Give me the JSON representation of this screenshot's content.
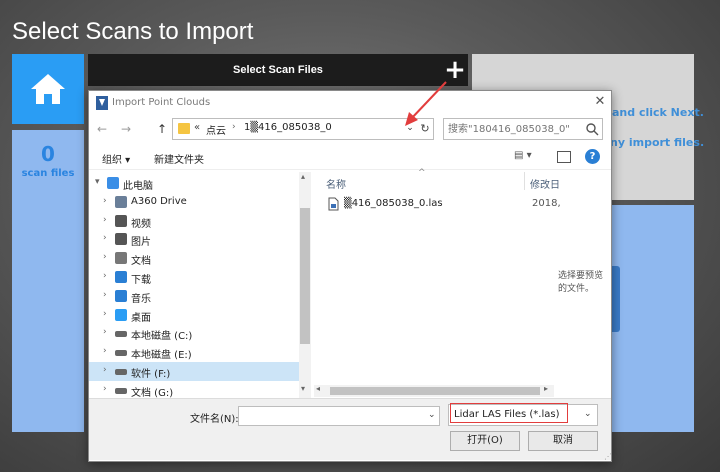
{
  "app": {
    "title": "Select Scans to Import",
    "scan_count": "0",
    "scan_label": "scan files",
    "select_bar_label": "Select Scan Files",
    "plus_symbol": "+",
    "hint_line1": "and click Next.",
    "hint_line2": "ny import files."
  },
  "dialog": {
    "title": "Import Point Clouds",
    "close_symbol": "✕",
    "nav": {
      "back": "←",
      "forward": "→",
      "up": "↑"
    },
    "address": {
      "separator": "«",
      "segments": [
        "点云",
        "1▒416_085038_0"
      ]
    },
    "search_placeholder": "搜索\"180416_085038_0\"",
    "toolbar": {
      "organize_label": "组织 ▾",
      "new_folder_label": "新建文件夹",
      "view_label": "▤ ▾",
      "help_label": "?"
    },
    "tree": [
      {
        "label": "此电脑",
        "icon": "computer-icon",
        "chevron": "▾",
        "level": 0,
        "selected": false
      },
      {
        "label": "A360 Drive",
        "icon": "cloud-drive-icon",
        "chevron": "›",
        "level": 1,
        "selected": false
      },
      {
        "label": "视频",
        "icon": "video-icon",
        "chevron": "›",
        "level": 1,
        "selected": false
      },
      {
        "label": "图片",
        "icon": "picture-icon",
        "chevron": "›",
        "level": 1,
        "selected": false
      },
      {
        "label": "文档",
        "icon": "document-icon",
        "chevron": "›",
        "level": 1,
        "selected": false
      },
      {
        "label": "下载",
        "icon": "download-icon",
        "chevron": "›",
        "level": 1,
        "selected": false
      },
      {
        "label": "音乐",
        "icon": "music-icon",
        "chevron": "›",
        "level": 1,
        "selected": false
      },
      {
        "label": "桌面",
        "icon": "desktop-icon",
        "chevron": "›",
        "level": 1,
        "selected": false
      },
      {
        "label": "本地磁盘 (C:)",
        "icon": "drive-icon",
        "chevron": "›",
        "level": 1,
        "selected": false
      },
      {
        "label": "本地磁盘 (E:)",
        "icon": "drive-icon",
        "chevron": "›",
        "level": 1,
        "selected": false
      },
      {
        "label": "软件 (F:)",
        "icon": "drive-icon",
        "chevron": "›",
        "level": 1,
        "selected": true
      },
      {
        "label": "文档 (G:)",
        "icon": "drive-icon",
        "chevron": "›",
        "level": 1,
        "selected": false
      }
    ],
    "columns": {
      "name": "名称",
      "date": "修改日"
    },
    "files": [
      {
        "name": "▒416_085038_0.las",
        "date": "2018,"
      }
    ],
    "preview_text": "选择要预览的文件。",
    "filename_label": "文件名(N):",
    "filename_value": "",
    "filter_label": "Lidar LAS Files (*.las)",
    "open_label": "打开(O)",
    "cancel_label": "取消",
    "colors": {
      "accent": "#2a9df4",
      "highlight_box": "#e23d3d",
      "selected_row": "#cce4f7"
    }
  }
}
